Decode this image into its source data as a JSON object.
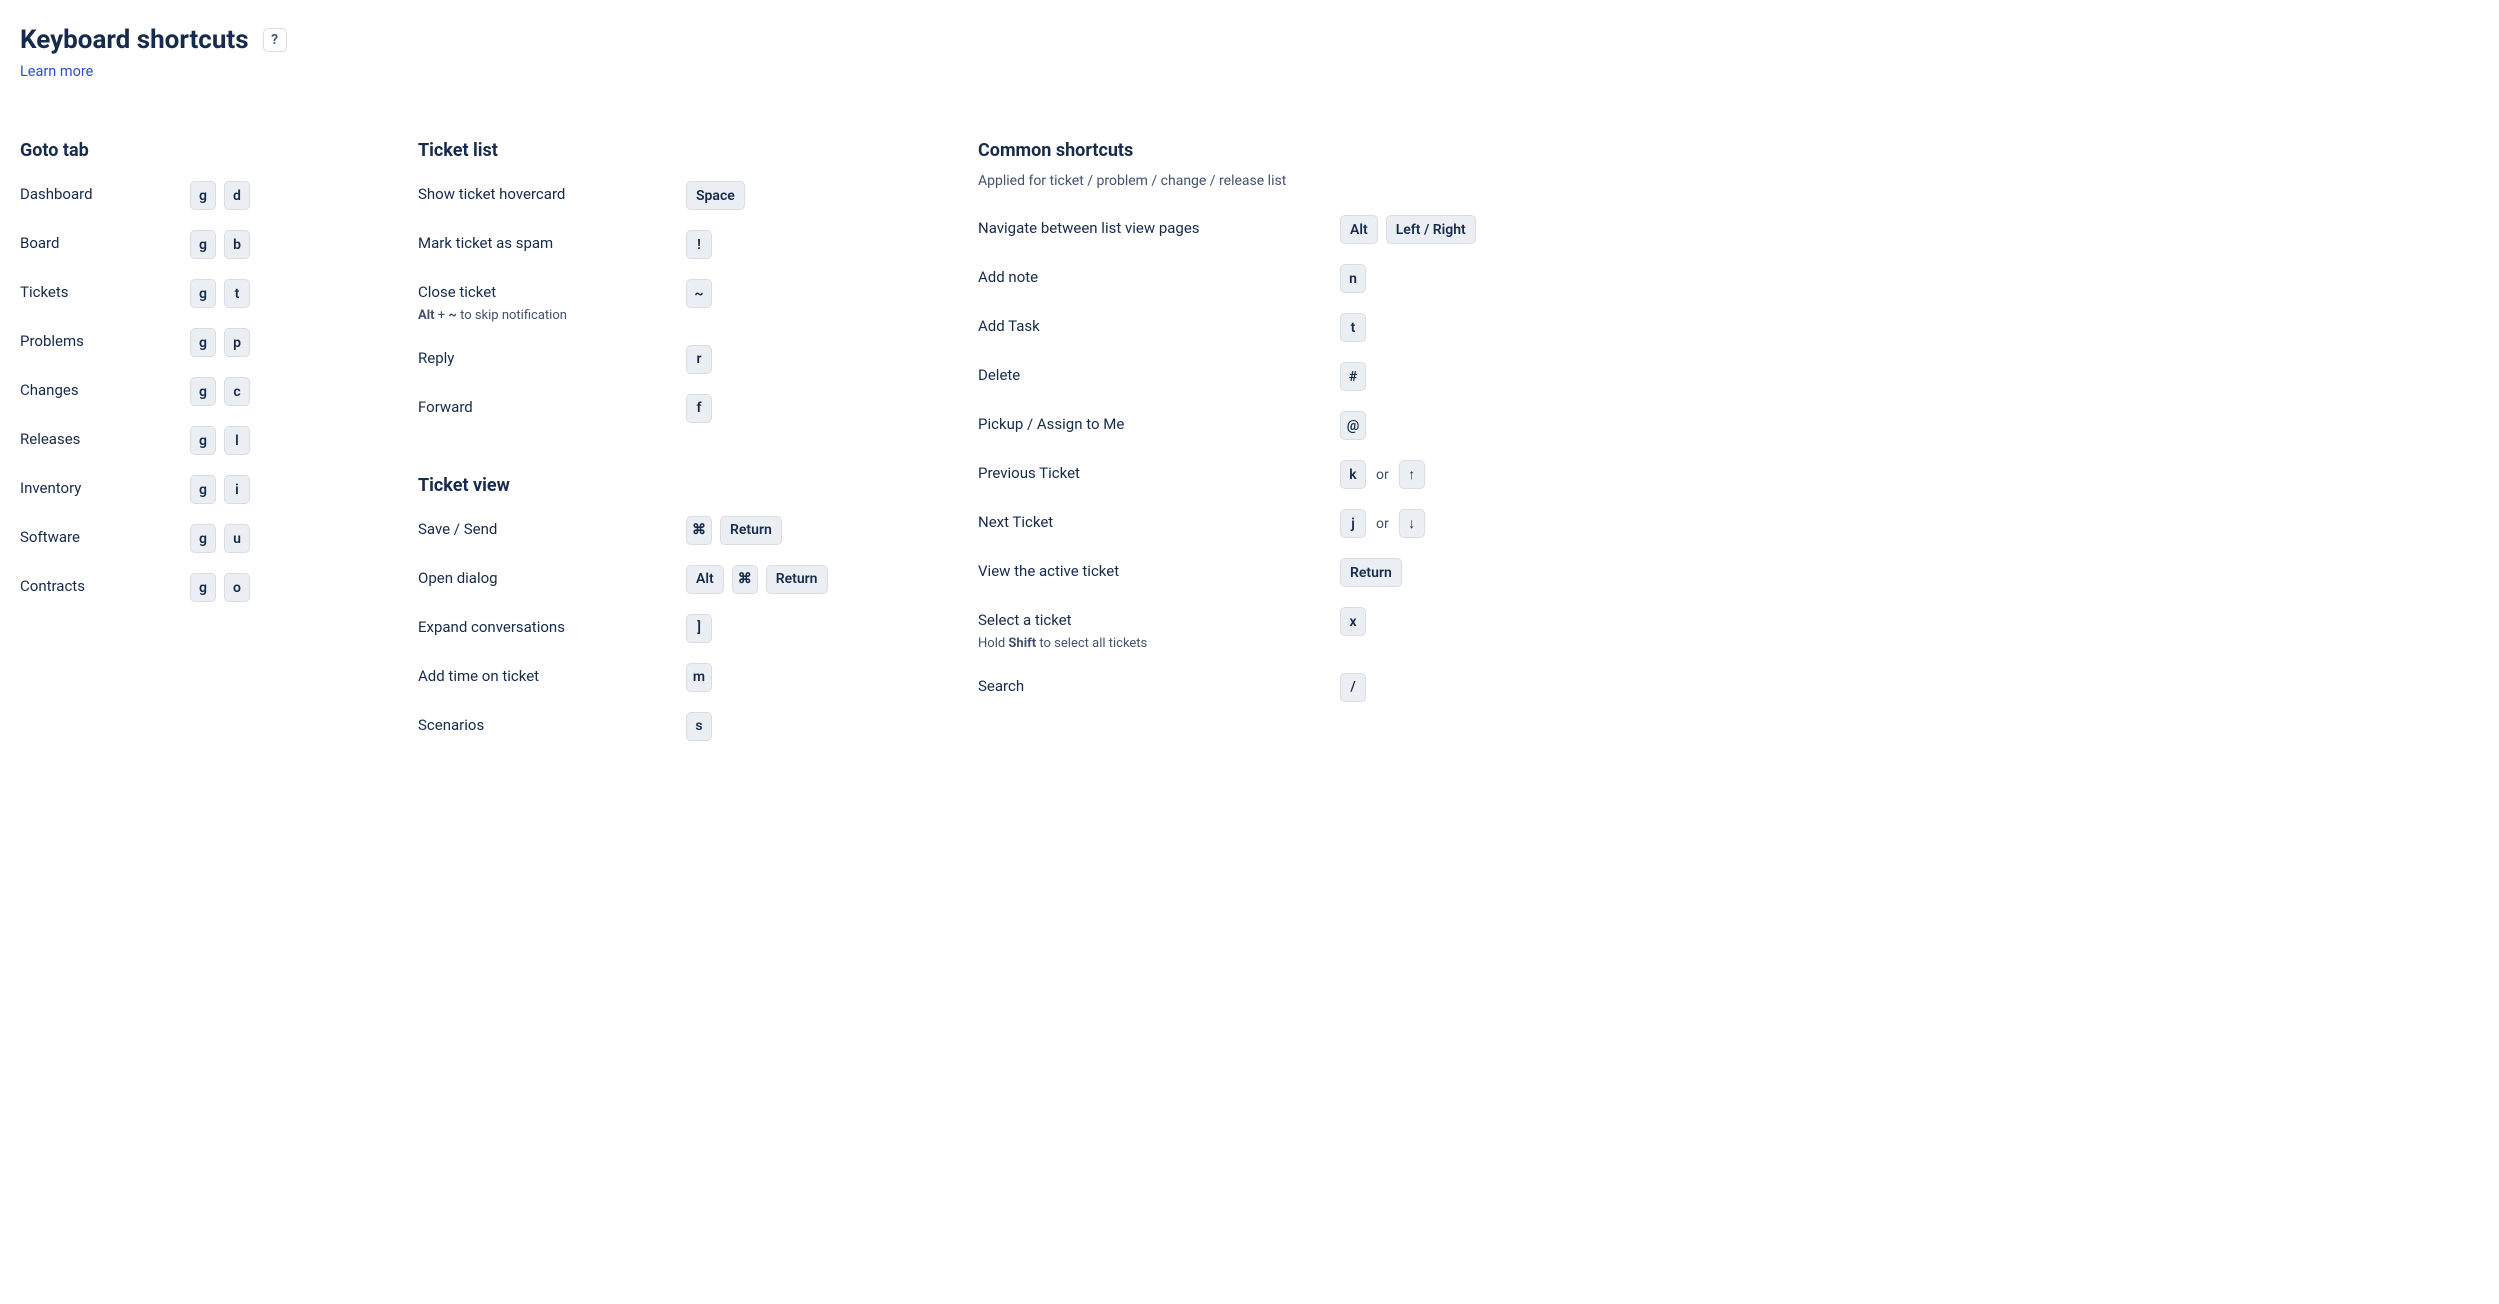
{
  "header": {
    "title": "Keyboard shortcuts",
    "help_label": "?",
    "learn_more": "Learn more"
  },
  "sep_or": "or",
  "col1": {
    "sections": [
      {
        "title": "Goto tab",
        "desc": "",
        "rows": [
          {
            "label": "Dashboard",
            "hint_parts": [],
            "keys": [
              "g",
              "d"
            ]
          },
          {
            "label": "Board",
            "hint_parts": [],
            "keys": [
              "g",
              "b"
            ]
          },
          {
            "label": "Tickets",
            "hint_parts": [],
            "keys": [
              "g",
              "t"
            ]
          },
          {
            "label": "Problems",
            "hint_parts": [],
            "keys": [
              "g",
              "p"
            ]
          },
          {
            "label": "Changes",
            "hint_parts": [],
            "keys": [
              "g",
              "c"
            ]
          },
          {
            "label": "Releases",
            "hint_parts": [],
            "keys": [
              "g",
              "l"
            ]
          },
          {
            "label": "Inventory",
            "hint_parts": [],
            "keys": [
              "g",
              "i"
            ]
          },
          {
            "label": "Software",
            "hint_parts": [],
            "keys": [
              "g",
              "u"
            ]
          },
          {
            "label": "Contracts",
            "hint_parts": [],
            "keys": [
              "g",
              "o"
            ]
          }
        ]
      }
    ]
  },
  "col2": {
    "sections": [
      {
        "title": "Ticket list",
        "desc": "",
        "rows": [
          {
            "label": "Show ticket hovercard",
            "hint_parts": [],
            "keys": [
              "Space"
            ]
          },
          {
            "label": "Mark ticket as spam",
            "hint_parts": [],
            "keys": [
              "!"
            ]
          },
          {
            "label": "Close ticket",
            "hint_parts": [
              {
                "b": true,
                "t": "Alt"
              },
              {
                "b": false,
                "t": " + "
              },
              {
                "b": true,
                "t": "~"
              },
              {
                "b": false,
                "t": " to skip notification"
              }
            ],
            "keys": [
              "~"
            ]
          },
          {
            "label": "Reply",
            "hint_parts": [],
            "keys": [
              "r"
            ]
          },
          {
            "label": "Forward",
            "hint_parts": [],
            "keys": [
              "f"
            ]
          }
        ]
      },
      {
        "title": "Ticket view",
        "desc": "",
        "rows": [
          {
            "label": "Save / Send",
            "hint_parts": [],
            "keys": [
              "⌘",
              "Return"
            ]
          },
          {
            "label": "Open dialog",
            "hint_parts": [],
            "keys": [
              "Alt",
              "⌘",
              "Return"
            ]
          },
          {
            "label": "Expand conversations",
            "hint_parts": [],
            "keys": [
              "]"
            ]
          },
          {
            "label": "Add time on ticket",
            "hint_parts": [],
            "keys": [
              "m"
            ]
          },
          {
            "label": "Scenarios",
            "hint_parts": [],
            "keys": [
              "s"
            ]
          }
        ]
      }
    ]
  },
  "col3": {
    "sections": [
      {
        "title": "Common shortcuts",
        "desc": "Applied for ticket / problem / change / release list",
        "rows": [
          {
            "label": "Navigate between list view pages",
            "hint_parts": [],
            "keys": [
              "Alt",
              "Left / Right"
            ]
          },
          {
            "label": "Add note",
            "hint_parts": [],
            "keys": [
              "n"
            ]
          },
          {
            "label": "Add Task",
            "hint_parts": [],
            "keys": [
              "t"
            ]
          },
          {
            "label": "Delete",
            "hint_parts": [],
            "keys": [
              "#"
            ]
          },
          {
            "label": "Pickup / Assign to Me",
            "hint_parts": [],
            "keys": [
              "@"
            ]
          },
          {
            "label": "Previous Ticket",
            "hint_parts": [],
            "keys": [
              "k",
              "or",
              "↑"
            ]
          },
          {
            "label": "Next Ticket",
            "hint_parts": [],
            "keys": [
              "j",
              "or",
              "↓"
            ]
          },
          {
            "label": "View the active ticket",
            "hint_parts": [],
            "keys": [
              "Return"
            ]
          },
          {
            "label": "Select a ticket",
            "hint_parts": [
              {
                "b": false,
                "t": "Hold "
              },
              {
                "b": true,
                "t": "Shift"
              },
              {
                "b": false,
                "t": " to select all tickets"
              }
            ],
            "keys": [
              "x"
            ]
          },
          {
            "label": "Search",
            "hint_parts": [],
            "keys": [
              "/"
            ]
          }
        ]
      }
    ]
  }
}
